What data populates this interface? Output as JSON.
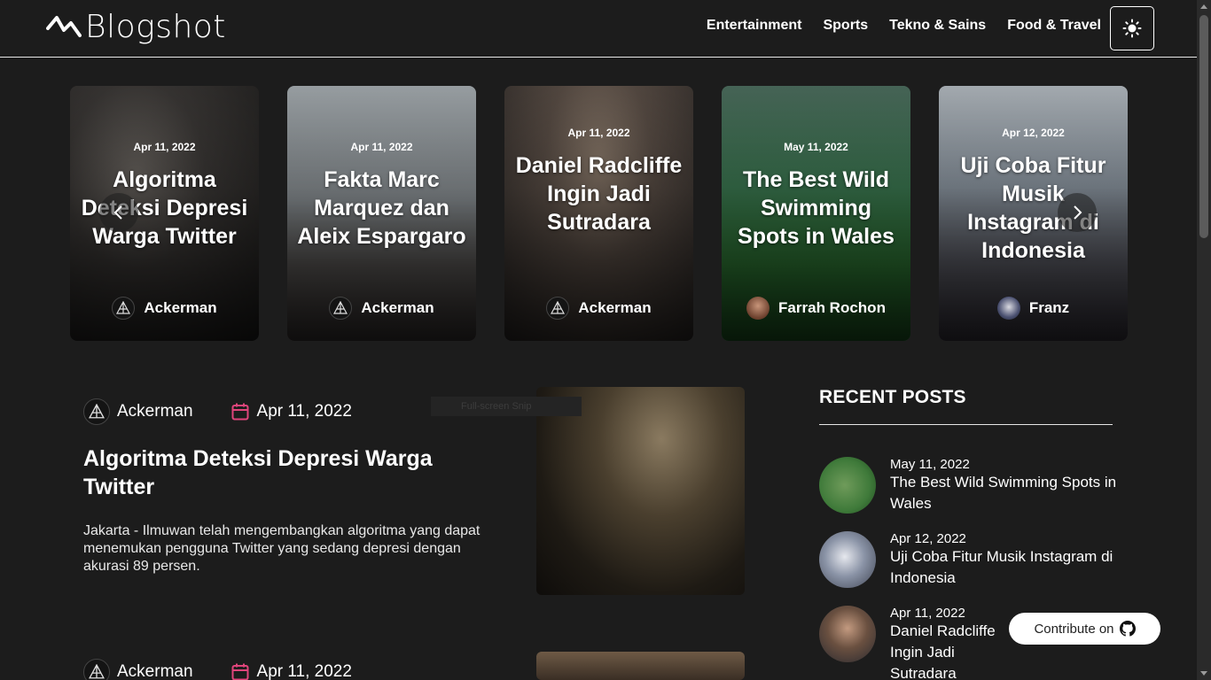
{
  "header": {
    "brand": "Blogshot",
    "nav": [
      "Entertainment",
      "Sports",
      "Tekno & Sains",
      "Food & Travel"
    ]
  },
  "carousel": [
    {
      "date": "Apr 11, 2022",
      "title": "Algoritma Deteksi Depresi Warga Twitter",
      "author": "Ackerman"
    },
    {
      "date": "Apr 11, 2022",
      "title": "Fakta Marc Marquez dan Aleix Espargaro",
      "author": "Ackerman"
    },
    {
      "date": "Apr 11, 2022",
      "title": "Daniel Radcliffe Ingin Jadi Sutradara",
      "author": "Ackerman"
    },
    {
      "date": "May 11, 2022",
      "title": "The Best Wild Swimming Spots in Wales",
      "author": "Farrah Rochon"
    },
    {
      "date": "Apr 12, 2022",
      "title": "Uji Coba Fitur Musik Instagram di Indonesia",
      "author": "Franz"
    }
  ],
  "articles": [
    {
      "author": "Ackerman",
      "date": "Apr 11, 2022",
      "title": "Algoritma Deteksi Depresi Warga Twitter",
      "excerpt": "Jakarta - Ilmuwan telah mengembangkan algoritma yang dapat menemukan pengguna Twitter yang sedang depresi dengan akurasi 89 persen."
    },
    {
      "author": "Ackerman",
      "date": "Apr 11, 2022"
    }
  ],
  "tooltip": "Full-screen Snip",
  "sidebar": {
    "heading": "RECENT POSTS",
    "posts": [
      {
        "date": "May 11, 2022",
        "title": "The Best Wild Swimming Spots in Wales"
      },
      {
        "date": "Apr 12, 2022",
        "title": "Uji Coba Fitur Musik Instagram di Indonesia"
      },
      {
        "date": "Apr 11, 2022",
        "title": "Daniel Radcliffe Ingin Jadi Sutradara"
      }
    ]
  },
  "contribute": "Contribute on",
  "colors": {
    "background": "#1c1c1c",
    "accent_calendar": "#e0457b",
    "text": "#ffffff"
  }
}
